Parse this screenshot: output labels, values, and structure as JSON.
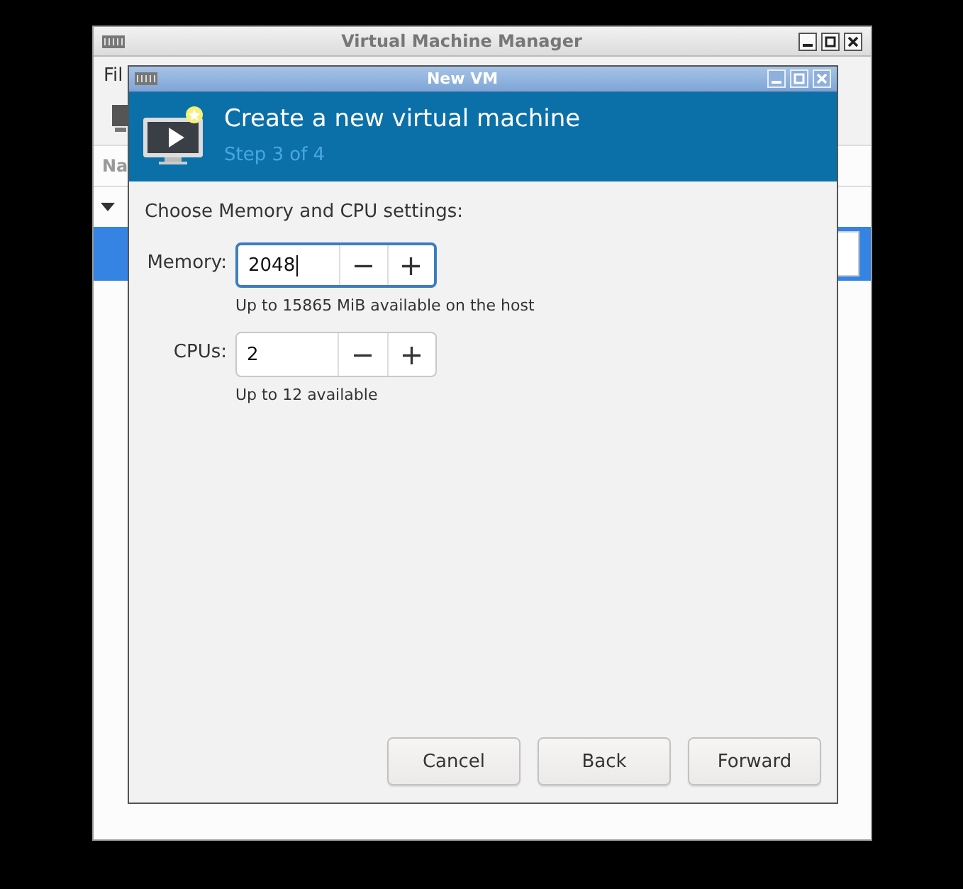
{
  "back_window": {
    "title": "Virtual Machine Manager",
    "menu_label": "Fil",
    "column_header": "Na",
    "group_expanded": true,
    "rows": [
      {
        "selected": true
      }
    ]
  },
  "dialog": {
    "title": "New VM",
    "header": {
      "title": "Create a new virtual machine",
      "step": "Step 3 of 4"
    },
    "prompt": "Choose Memory and CPU settings:",
    "fields": [
      {
        "label": "Memory:",
        "value": "2048",
        "hint": "Up to 15865 MiB available on the host",
        "focused": true,
        "decrement": "−",
        "increment": "+"
      },
      {
        "label": "CPUs:",
        "value": "2",
        "hint": "Up to 12 available",
        "focused": false,
        "decrement": "−",
        "increment": "+"
      }
    ],
    "buttons": [
      "Cancel",
      "Back",
      "Forward"
    ]
  }
}
